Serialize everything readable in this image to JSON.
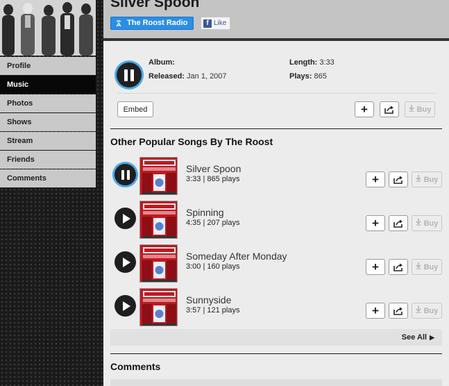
{
  "song": {
    "title": "Silver Spoon",
    "artist_link": "The Roost Radio",
    "facebook_like": "Like",
    "album_label": "Album:",
    "album_value": "",
    "released_label": "Released:",
    "released_value": "Jan 1, 2007",
    "length_label": "Length:",
    "length_value": "3:33",
    "plays_label": "Plays:",
    "plays_value": "865",
    "embed_label": "Embed",
    "buy_label": "Buy"
  },
  "nav": {
    "items": [
      {
        "label": "Profile"
      },
      {
        "label": "Music"
      },
      {
        "label": "Photos"
      },
      {
        "label": "Shows"
      },
      {
        "label": "Stream"
      },
      {
        "label": "Friends"
      },
      {
        "label": "Comments"
      }
    ],
    "active": "Music"
  },
  "popular": {
    "heading": "Other Popular Songs By The Roost",
    "songs": [
      {
        "title": "Silver Spoon",
        "meta": "3:33 | 865 plays",
        "state": "pause"
      },
      {
        "title": "Spinning",
        "meta": "4:35 | 207 plays",
        "state": "play"
      },
      {
        "title": "Someday After Monday",
        "meta": "3:00 | 160 plays",
        "state": "play"
      },
      {
        "title": "Sunnyside",
        "meta": "3:57 | 121 plays",
        "state": "play"
      }
    ],
    "buy_label": "Buy",
    "see_all": "See All"
  },
  "comments": {
    "heading": "Comments"
  },
  "icons": {
    "artist_link": "radio-antenna-icon",
    "facebook": "facebook-f-icon",
    "add": "plus-icon",
    "share": "share-arrow-icon",
    "buy": "download-arrow-icon",
    "play": "play-icon",
    "pause": "pause-icon",
    "see_all": "triangle-right-icon"
  },
  "colors": {
    "accent": "#2b8ee6",
    "glow": "#4aa8ee",
    "active_nav": "#080808"
  }
}
